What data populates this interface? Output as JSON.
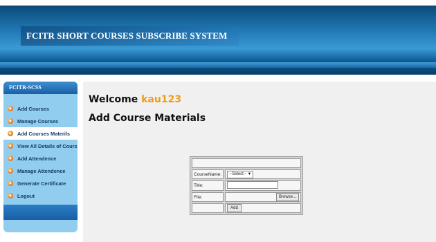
{
  "header": {
    "title": "FCITR SHORT COURSES SUBSCRIBE SYSTEM"
  },
  "sidebar": {
    "title": "FCITR-SCSS",
    "items": [
      {
        "label": "Add Courses",
        "active": false
      },
      {
        "label": "Manage Courses",
        "active": false
      },
      {
        "label": "Add Courses Materils",
        "active": true
      },
      {
        "label": "View All Details of Courses",
        "active": false
      },
      {
        "label": "Add Attendence",
        "active": false
      },
      {
        "label": "Manage Attendence",
        "active": false
      },
      {
        "label": "Generate Certificate",
        "active": false
      },
      {
        "label": "Logout",
        "active": false
      }
    ]
  },
  "main": {
    "welcome_label": "Welcome",
    "username": "kau123",
    "page_title": "Add Course Materials"
  },
  "form": {
    "course_label": "CourseName:",
    "course_selected": "--Select--",
    "title_label": "Title:",
    "file_label": "File:",
    "browse_label": "Browse...",
    "add_label": "Add"
  },
  "colors": {
    "accent_username": "#f39a12",
    "sidebar_bg": "#91cdee",
    "header_dark": "#0b4a78"
  }
}
